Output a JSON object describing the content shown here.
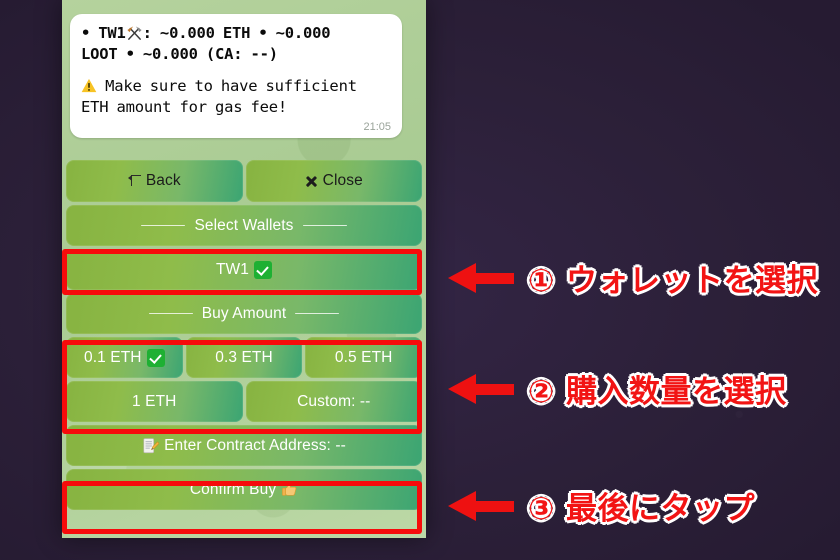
{
  "theme": {
    "backdrop_color": "#2a1d3d",
    "wallpaper_color": "#aecd96",
    "button_gradient_start": "#87b341",
    "button_gradient_end": "#3ba573",
    "highlight_color": "#f60b0b",
    "annotation_text_color": "#f21414",
    "check_badge_color": "#1eb033"
  },
  "message": {
    "line1_prefix": "• ",
    "line1_wallet": "TW1",
    "line1_icon": "hammer-and-pick-emoji",
    "line1_rest": ": ~0.000 ETH  •  ~0.000",
    "line2": "LOOT • ~0.000 (CA: --)",
    "warning_icon": "warning-emoji",
    "warning_line1": "Make sure to have sufficient",
    "warning_line2": "ETH amount for gas fee!",
    "time": "21:05"
  },
  "keyboard": {
    "rows": [
      {
        "name": "nav-row",
        "buttons": [
          {
            "name": "back-button",
            "label": "Back",
            "icon": "back-arrow-icon",
            "interactable": true
          },
          {
            "name": "close-button",
            "label": "Close",
            "icon": "close-x-icon",
            "interactable": true
          }
        ]
      },
      {
        "name": "select-wallets-separator",
        "buttons": [
          {
            "name": "select-wallets-header",
            "label": "Select Wallets",
            "separator": true,
            "interactable": true
          }
        ]
      },
      {
        "name": "wallet-row",
        "buttons": [
          {
            "name": "wallet-tw1-button",
            "label": "TW1",
            "icon": "check-mark-emoji",
            "interactable": true
          }
        ]
      },
      {
        "name": "buy-amount-separator",
        "buttons": [
          {
            "name": "buy-amount-header",
            "label": "Buy Amount",
            "separator": true,
            "interactable": true
          }
        ]
      },
      {
        "name": "amount-row-1",
        "buttons": [
          {
            "name": "amount-0-1-eth-button",
            "label": "0.1 ETH",
            "icon": "check-mark-emoji",
            "interactable": true
          },
          {
            "name": "amount-0-3-eth-button",
            "label": "0.3 ETH",
            "interactable": true
          },
          {
            "name": "amount-0-5-eth-button",
            "label": "0.5 ETH",
            "interactable": true
          }
        ]
      },
      {
        "name": "amount-row-2",
        "buttons": [
          {
            "name": "amount-1-eth-button",
            "label": "1 ETH",
            "interactable": true
          },
          {
            "name": "amount-custom-button",
            "label": "Custom: --",
            "interactable": true
          }
        ]
      },
      {
        "name": "contract-row",
        "buttons": [
          {
            "name": "enter-contract-address-button",
            "label": "Enter Contract Address: --",
            "icon": "memo-emoji",
            "icon_leading": true,
            "interactable": true
          }
        ]
      },
      {
        "name": "confirm-row",
        "buttons": [
          {
            "name": "confirm-buy-button",
            "label": "Confirm Buy",
            "icon": "thumbs-up-emoji",
            "interactable": true
          }
        ]
      }
    ]
  },
  "annotations": [
    {
      "name": "annotation-step-1",
      "arrow": "left-arrow-icon",
      "text": "① ウォレットを選択"
    },
    {
      "name": "annotation-step-2",
      "arrow": "left-arrow-icon",
      "text": "② 購入数量を選択"
    },
    {
      "name": "annotation-step-3",
      "arrow": "left-arrow-icon",
      "text": "③ 最後にタップ"
    }
  ],
  "highlights": [
    {
      "name": "highlight-wallet-row"
    },
    {
      "name": "highlight-amount-grid"
    },
    {
      "name": "highlight-confirm-buy"
    }
  ]
}
